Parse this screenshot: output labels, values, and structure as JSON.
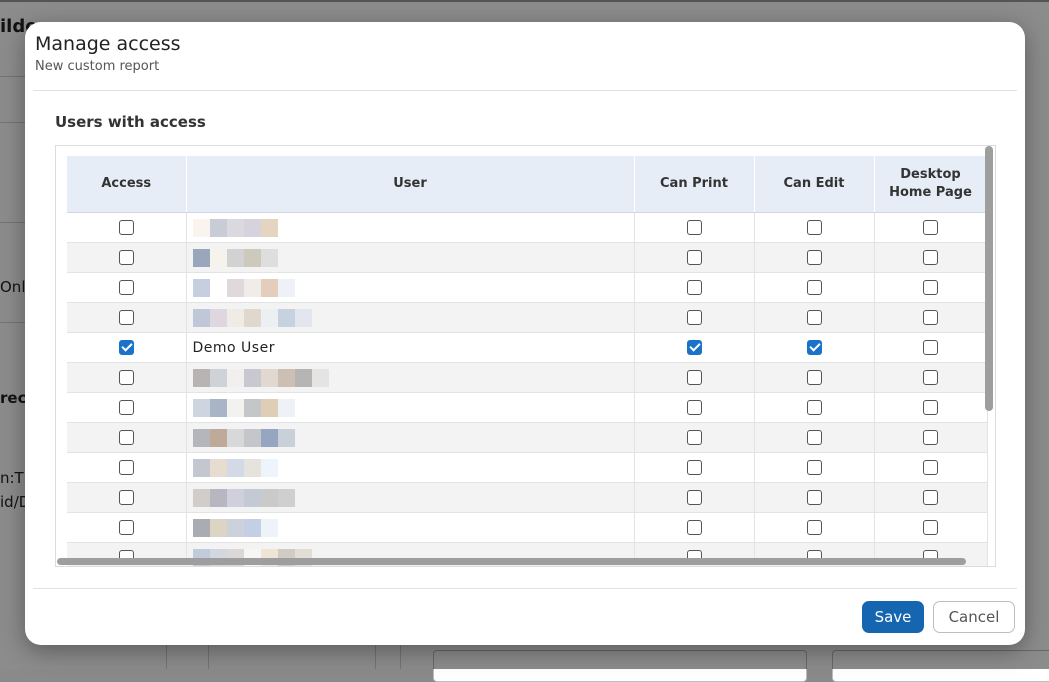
{
  "background_fragments": [
    "ilde",
    "Only",
    "rece",
    "n:Th",
    "id/D"
  ],
  "modal": {
    "title": "Manage access",
    "subtitle": "New custom report",
    "section_title": "Users with access"
  },
  "table": {
    "columns": [
      "Access",
      "User",
      "Can Print",
      "Can Edit",
      "Desktop Home Page"
    ],
    "rows": [
      {
        "user": "",
        "access": false,
        "can_print": false,
        "can_edit": false,
        "desktop_home_page": false,
        "blur": [
          "#faf4ee",
          "#c8ccd6",
          "#dad9e0",
          "#d6d2de",
          "#e4d4c0"
        ]
      },
      {
        "user": "",
        "access": false,
        "can_print": false,
        "can_edit": false,
        "desktop_home_page": false,
        "blur": [
          "#9aa6bc",
          "#f6f4ea",
          "#d2d2d2",
          "#cdc9bc",
          "#dedede"
        ]
      },
      {
        "user": "",
        "access": false,
        "can_print": false,
        "can_edit": false,
        "desktop_home_page": false,
        "blur": [
          "#c6cfe0",
          "#ffffff",
          "#e1d8dc",
          "#f0ece8",
          "#e4cdba",
          "#eef2f8"
        ]
      },
      {
        "user": "",
        "access": false,
        "can_print": false,
        "can_edit": false,
        "desktop_home_page": false,
        "blur": [
          "#bfc7d9",
          "#dfd6e0",
          "#efebe5",
          "#e0d8cd",
          "#edf0f3",
          "#c7d2e1",
          "#e3e6ee"
        ]
      },
      {
        "user": "Demo User",
        "access": true,
        "can_print": true,
        "can_edit": true,
        "desktop_home_page": false,
        "blur": []
      },
      {
        "user": "",
        "access": false,
        "can_print": false,
        "can_edit": false,
        "desktop_home_page": false,
        "blur": [
          "#b8b4b3",
          "#cfd3d8",
          "#f1f0ee",
          "#c9c8d0",
          "#e1d9cf",
          "#cdbfb4",
          "#b7b5b4",
          "#e4e4e4"
        ]
      },
      {
        "user": "",
        "access": false,
        "can_print": false,
        "can_edit": false,
        "desktop_home_page": false,
        "blur": [
          "#ccd5e0",
          "#a9b4c6",
          "#f4f2ee",
          "#c4c6c7",
          "#e0cdb5",
          "#eef1f6"
        ]
      },
      {
        "user": "",
        "access": false,
        "can_print": false,
        "can_edit": false,
        "desktop_home_page": false,
        "blur": [
          "#b5b6bb",
          "#bfaa9a",
          "#d8d8d8",
          "#c4c6cb",
          "#97a6c0",
          "#c8d0da"
        ]
      },
      {
        "user": "",
        "access": false,
        "can_print": false,
        "can_edit": false,
        "desktop_home_page": false,
        "blur": [
          "#c5c7d0",
          "#e8dcd0",
          "#d4dae5",
          "#e6e2dc",
          "#eef4fb"
        ]
      },
      {
        "user": "",
        "access": false,
        "can_print": false,
        "can_edit": false,
        "desktop_home_page": false,
        "blur": [
          "#d2cdc8",
          "#b8b6c0",
          "#cfd0dc",
          "#c4cad3",
          "#cacaca",
          "#cfcfcf"
        ]
      },
      {
        "user": "",
        "access": false,
        "can_print": false,
        "can_edit": false,
        "desktop_home_page": false,
        "blur": [
          "#a9acb2",
          "#dcd5c4",
          "#cdd1dc",
          "#c3d0e4",
          "#eef3fa"
        ]
      },
      {
        "user": "",
        "access": false,
        "can_print": false,
        "can_edit": false,
        "desktop_home_page": false,
        "blur": [
          "#c0ccdc",
          "#d4d7df",
          "#ddd8d8",
          "#f6f6f4",
          "#efe4d6",
          "#d2cbc5",
          "#e2ddd5"
        ]
      }
    ]
  },
  "buttons": {
    "save": "Save",
    "cancel": "Cancel"
  },
  "colors": {
    "primary": "#1565b0",
    "checkbox_checked": "#1a73c8",
    "header_bg": "#e6edf7"
  }
}
